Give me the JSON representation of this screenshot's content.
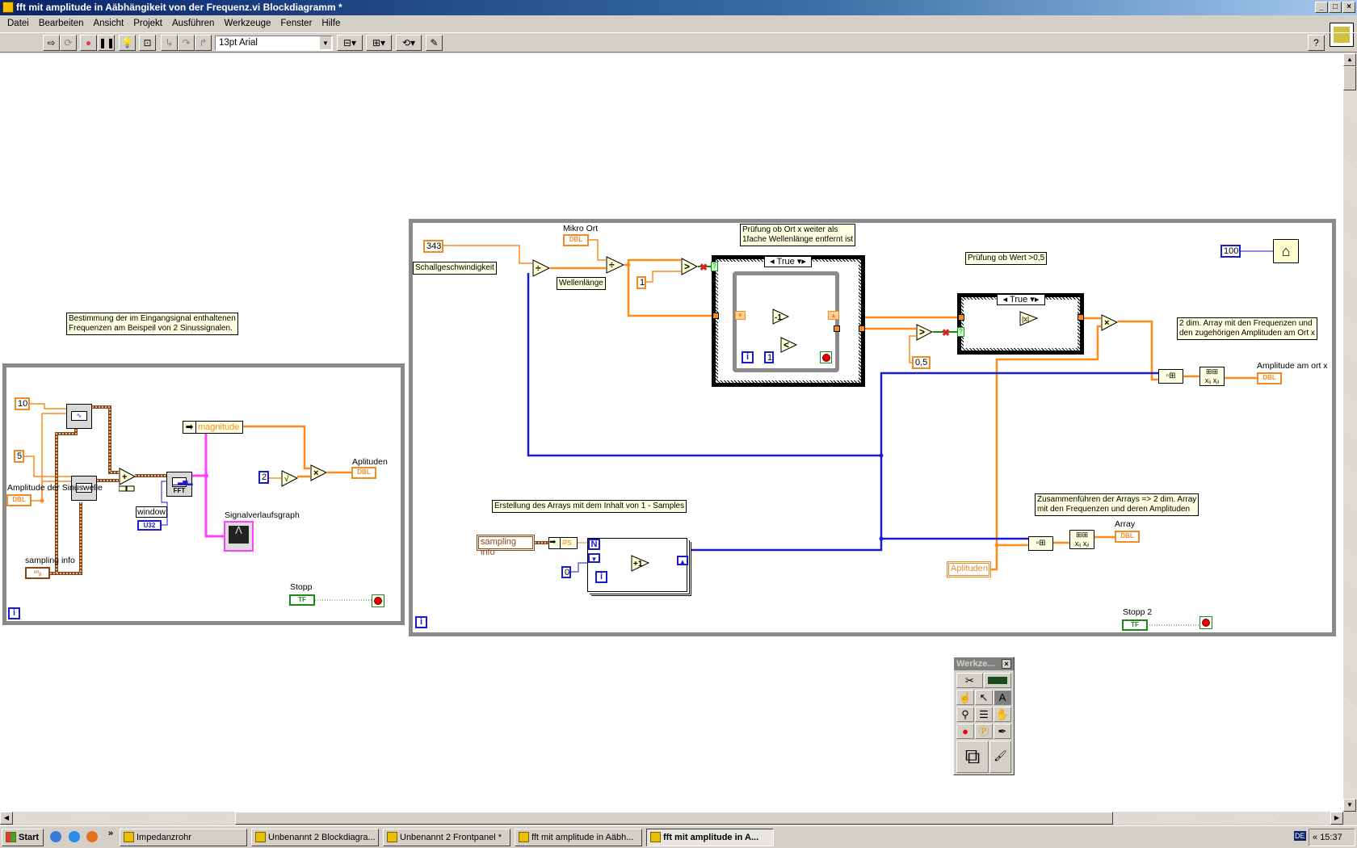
{
  "window": {
    "title": "fft mit amplitude in Aäbhängikeit von der Frequenz.vi Blockdiagramm *"
  },
  "menu": [
    "Datei",
    "Bearbeiten",
    "Ansicht",
    "Projekt",
    "Ausführen",
    "Werkzeuge",
    "Fenster",
    "Hilfe"
  ],
  "toolbar": {
    "font": "13pt Arial",
    "help": "?"
  },
  "left_loop": {
    "comment": [
      "Bestimmung der im Eingangsignal enthaltenen",
      "Frequenzen am Beispeil von 2 Sinussignalen."
    ],
    "const_10": "10",
    "const_5": "5",
    "amplitude_label": "Amplitude der Sinuswelle",
    "amplitude_type": "DBL",
    "sampling_label": "sampling info",
    "sampling_type": "⁹⁰ᵦ",
    "unbundle_field": "magnitude",
    "fft_label": "FFT",
    "window_label": "window",
    "window_type": "U32",
    "graph_label": "Signalverlaufsgraph",
    "const_2": "2",
    "multiply_symbol": "×",
    "add_symbol": "+",
    "sqrt_symbol": "√",
    "out_label": "Aplituden",
    "out_type": "DBL",
    "stop_label": "Stopp",
    "stop_type": "TF",
    "iter": "i"
  },
  "right_loop": {
    "const_343": "343",
    "speed_label": "Schallgeschwindigkeit",
    "mikro_label": "Mikro Ort",
    "mikro_type": "DBL",
    "wave_label": "Wellenlänge",
    "divide_symbol": "÷",
    "greater_symbol": ">",
    "less_symbol": "<",
    "const_1": "1",
    "comment_ort": [
      "Prüfung ob Ort x weiter als",
      "1fache Wellenlänge entfernt ist"
    ],
    "case1_selector": "True",
    "minus1": "-1",
    "inner_iter": "i",
    "inner_const_1": "1",
    "comment_wert": "Prüfung ob Wert >0,5",
    "const_05": "0,5",
    "case2_selector": "True",
    "abs_symbol": "|x|",
    "multiply_symbol": "×",
    "const_100": "100",
    "comment_2dim": [
      "2 dim. Array mit den Frequenzen und",
      "den zugehörigen Amplituden am Ort x"
    ],
    "amp_ort_label": "Amplitude am ort x",
    "amp_ort_type": "DBL",
    "comment_erstellung": "Erstellung des Arrays mit dem Inhalt von 1 - Samples",
    "sampling_local": "sampling info",
    "unbundle_s": "#s",
    "loop_n": "N",
    "const_0": "0",
    "for_iter": "i",
    "plus1": "+1",
    "comment_zusammen": [
      "Zusammenführen der Arrays => 2 dim. Array",
      "mit den Frequenzen und deren Amplituden"
    ],
    "array_label": "Array",
    "array_type": "DBL",
    "aplituden_local": "Aplituden",
    "stop2_label": "Stopp 2",
    "stop2_type": "TF",
    "iter": "i"
  },
  "tools_palette": {
    "title": "Werkze...",
    "close": "×"
  },
  "taskbar": {
    "start": "Start",
    "quicklaunch_more": "»",
    "items": [
      "Impedanzrohr",
      "Unbenannt 2 Blockdiagra...",
      "Unbenannt 2 Frontpanel *",
      "fft mit amplitude in Aäbh...",
      "fft mit amplitude in A..."
    ],
    "lang": "DE",
    "clock": "15:37"
  },
  "colors": {
    "dbl_wire": "#ff8c1a",
    "int_wire": "#1a1ad0",
    "cluster_wire": "#8b4513",
    "waveform_wire": "#ff40ff",
    "bool_wire": "#1a8a1a",
    "titlebar": "#0a246a"
  }
}
